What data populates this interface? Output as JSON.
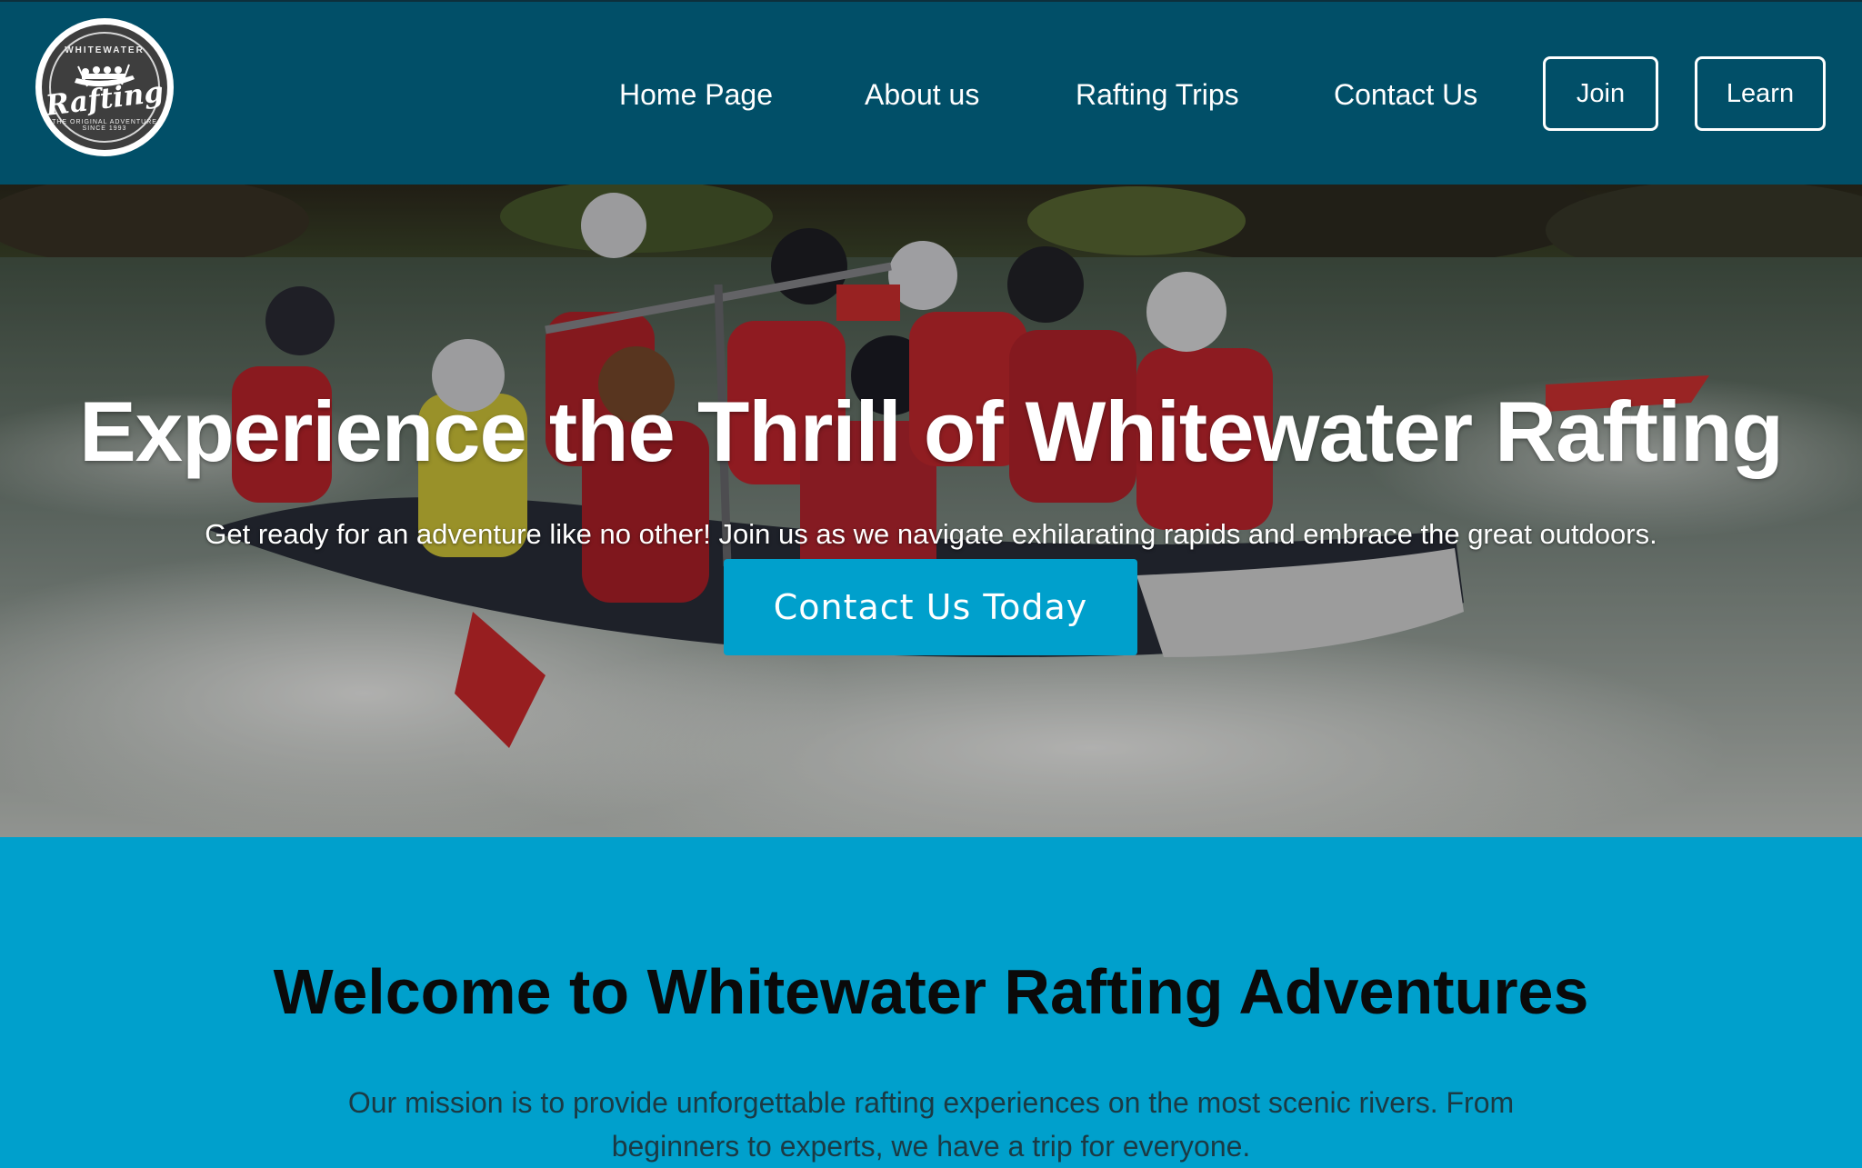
{
  "header": {
    "logo": {
      "arc_top": "WHITEWATER",
      "word": "Rafting",
      "arc_bottom": "THE ORIGINAL ADVENTURE SINCE 1993",
      "icon": "raft-logo-icon"
    },
    "nav": [
      {
        "label": "Home Page"
      },
      {
        "label": "About us"
      },
      {
        "label": "Rafting Trips"
      },
      {
        "label": "Contact Us"
      }
    ],
    "join_label": "Join",
    "learn_label": "Learn"
  },
  "hero": {
    "title": "Experience the Thrill of Whitewater Rafting",
    "subtitle": "Get ready for an adventure like no other! Join us as we navigate exhilarating rapids and embrace the great outdoors.",
    "cta_label": "Contact Us Today"
  },
  "welcome": {
    "title": "Welcome to Whitewater Rafting Adventures",
    "text": "Our mission is to provide unforgettable rafting experiences on the most scenic rivers. From beginners to experts, we have a trip for everyone."
  },
  "colors": {
    "header_bg": "#014f68",
    "accent": "#00a0cc",
    "text_dark": "#0a0a0a"
  }
}
